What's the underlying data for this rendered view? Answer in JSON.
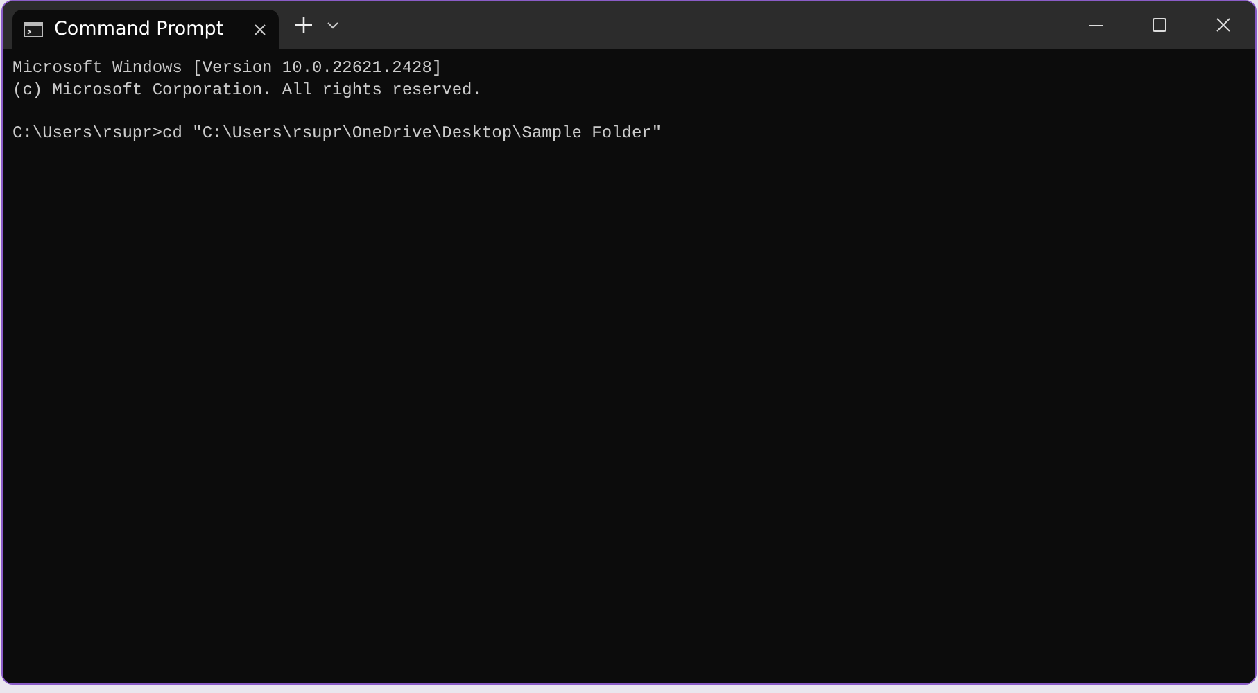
{
  "tabs": [
    {
      "label": "Command Prompt",
      "selected": true
    }
  ],
  "console": {
    "blocks": [
      [
        "Microsoft Windows [Version 10.0.22621.2428]",
        "(c) Microsoft Corporation. All rights reserved."
      ],
      [
        "C:\\Users\\rsupr>cd \"C:\\Users\\rsupr\\OneDrive\\Desktop\\Sample Folder\""
      ]
    ]
  }
}
